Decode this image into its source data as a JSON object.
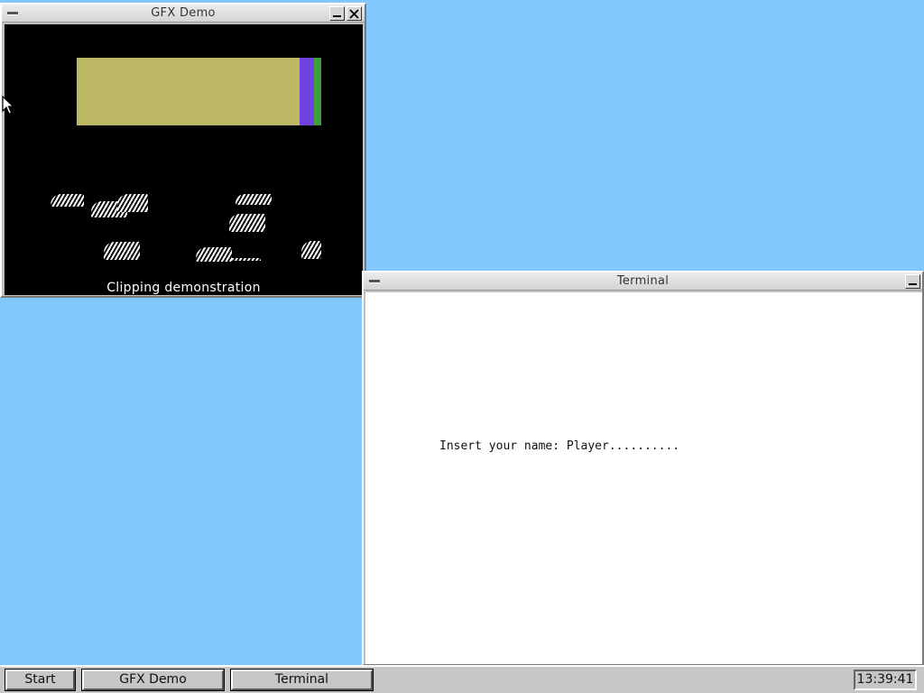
{
  "windows": {
    "gfx": {
      "title": "GFX Demo",
      "caption": "Clipping demonstration"
    },
    "terminal": {
      "title": "Terminal",
      "prompt_text": "Insert your name: Player.........."
    }
  },
  "colors": {
    "desktop": "#82c8fc",
    "bar_olive": "#bcb864",
    "bar_violet": "#7040e0",
    "bar_green": "#40a040"
  },
  "taskbar": {
    "start_label": "Start",
    "tasks": [
      "GFX Demo",
      "Terminal"
    ],
    "clock": "13:39:41"
  }
}
